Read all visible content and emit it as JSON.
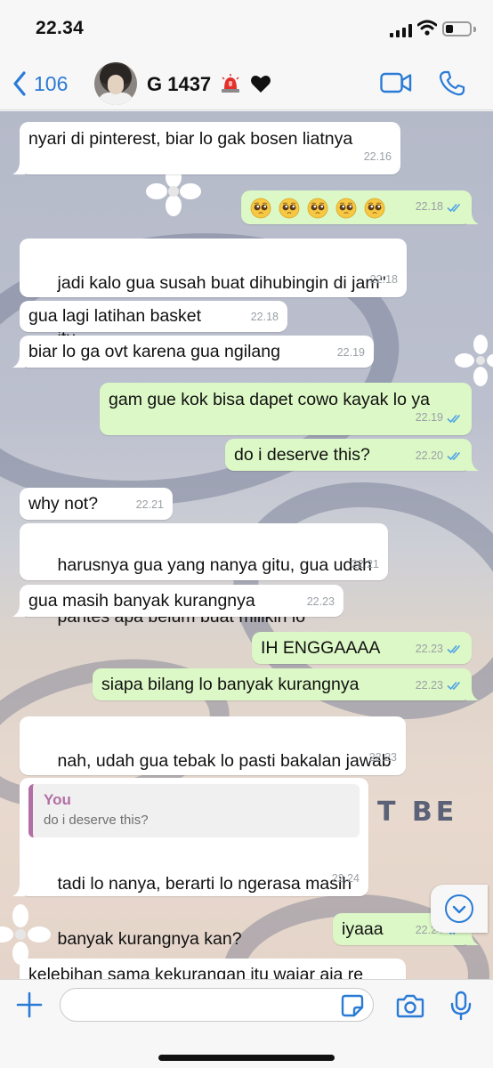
{
  "status_bar": {
    "time": "22.34"
  },
  "header": {
    "back_count": "106",
    "contact_name": "G 1437",
    "icons": [
      "chevron-left-icon",
      "police-light-icon",
      "black-heart-icon",
      "video-call-icon",
      "phone-icon"
    ]
  },
  "colors": {
    "accent": "#2a7bd6",
    "outgoing_bubble": "#dcf8c6",
    "incoming_bubble": "#ffffff",
    "reply_accent": "#b26fa5"
  },
  "background_text": "T BE",
  "messages": [
    {
      "dir": "in",
      "text": "nyari di pinterest, biar lo gak bosen liatnya",
      "time": "22.16"
    },
    {
      "dir": "out",
      "text": "",
      "emoji": "pleading-face-icon",
      "emoji_count": 5,
      "time": "22.18"
    },
    {
      "dir": "in",
      "text": "jadi kalo gua susah buat dihubingin di jam\" itu",
      "time": "22.18"
    },
    {
      "dir": "in",
      "text": "gua lagi latihan basket",
      "time": "22.18"
    },
    {
      "dir": "in",
      "text": "biar lo ga ovt karena gua ngilang",
      "time": "22.19"
    },
    {
      "dir": "out",
      "text": "gam gue kok bisa dapet cowo kayak lo ya",
      "time": "22.19"
    },
    {
      "dir": "out",
      "text": "do i deserve this?",
      "time": "22.20"
    },
    {
      "dir": "in",
      "text": "why not?",
      "time": "22.21"
    },
    {
      "dir": "in",
      "text": "harusnya gua yang nanya gitu, gua udah pantes apa belum buat milikin lo",
      "time": "22.21"
    },
    {
      "dir": "in",
      "text": "gua masih banyak kurangnya",
      "time": "22.23"
    },
    {
      "dir": "out",
      "text": "IH ENGGAAAA",
      "time": "22.23"
    },
    {
      "dir": "out",
      "text": "siapa bilang lo banyak kurangnya",
      "time": "22.23"
    },
    {
      "dir": "in",
      "text": "nah, udah gua tebak lo pasti bakalan jawab gitu",
      "time": "22.23"
    },
    {
      "dir": "in",
      "reply_to_name": "You",
      "reply_to_text": "do i deserve this?",
      "text": "tadi lo nanya, berarti lo ngerasa masih banyak kurangnya kan?",
      "time": "22.24"
    },
    {
      "dir": "out",
      "text": "iyaaa",
      "time": "22.24"
    },
    {
      "dir": "in",
      "text": "kelebihan sama kekurangan itu wajar aja re",
      "time": ""
    }
  ],
  "input": {
    "placeholder": "",
    "value": ""
  }
}
